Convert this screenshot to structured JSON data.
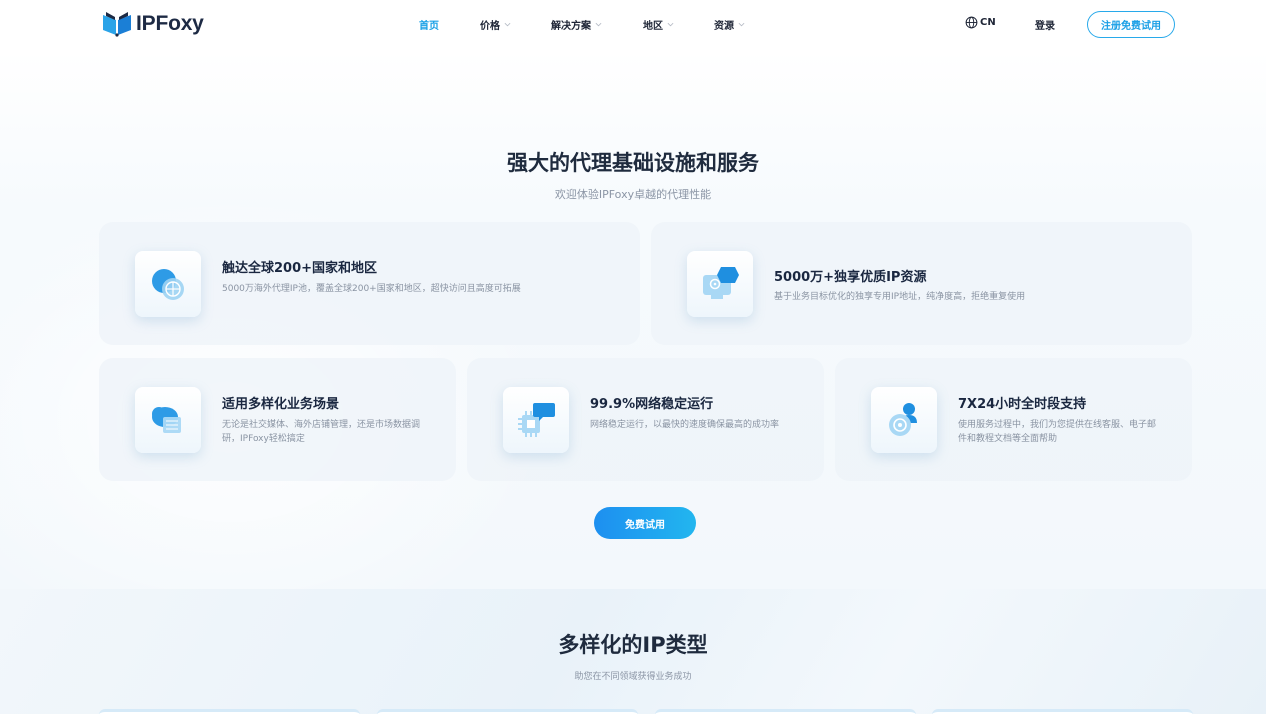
{
  "header": {
    "brand": "IPFoxy",
    "nav": [
      {
        "label": "首页",
        "active": true,
        "dropdown": false
      },
      {
        "label": "价格",
        "active": false,
        "dropdown": true
      },
      {
        "label": "解决方案",
        "active": false,
        "dropdown": true
      },
      {
        "label": "地区",
        "active": false,
        "dropdown": true
      },
      {
        "label": "资源",
        "active": false,
        "dropdown": true
      }
    ],
    "language": "CN",
    "login": "登录",
    "signup": "注册免费试用"
  },
  "hero": {
    "title": "强大的代理基础设施和服务",
    "subtitle": "欢迎体验IPFoxy卓越的代理性能",
    "features": [
      {
        "title": "触达全球200+国家和地区",
        "desc": "5000万海外代理IP池，覆盖全球200+国家和地区，超快访问且高度可拓展",
        "icon": "globe-icon"
      },
      {
        "title": "5000万+独享优质IP资源",
        "desc": "基于业务目标优化的独享专用IP地址，纯净度高，拒绝重复使用",
        "icon": "location-monitor-icon"
      },
      {
        "title": "适用多样化业务场景",
        "desc": "无论是社交媒体、海外店铺管理，还是市场数据调研，IPFoxy轻松搞定",
        "icon": "cloud-box-icon"
      },
      {
        "title": "99.9%网络稳定运行",
        "desc": "网络稳定运行，以最快的速度确保最高的成功率",
        "icon": "chip-chat-icon"
      },
      {
        "title": "7X24小时全时段支持",
        "desc": "使用服务过程中，我们为您提供在线客服、电子邮件和教程文档等全面帮助",
        "icon": "support-agent-icon"
      }
    ],
    "cta": "免费试用"
  },
  "ip_types": {
    "title": "多样化的IP类型",
    "subtitle": "助您在不同领域获得业务成功"
  },
  "colors": {
    "accent": "#18a0e6",
    "cta_gradient_start": "#1d8ff0",
    "cta_gradient_end": "#22b6ef",
    "heading": "#1f2b3e",
    "muted": "#8b95a5"
  }
}
